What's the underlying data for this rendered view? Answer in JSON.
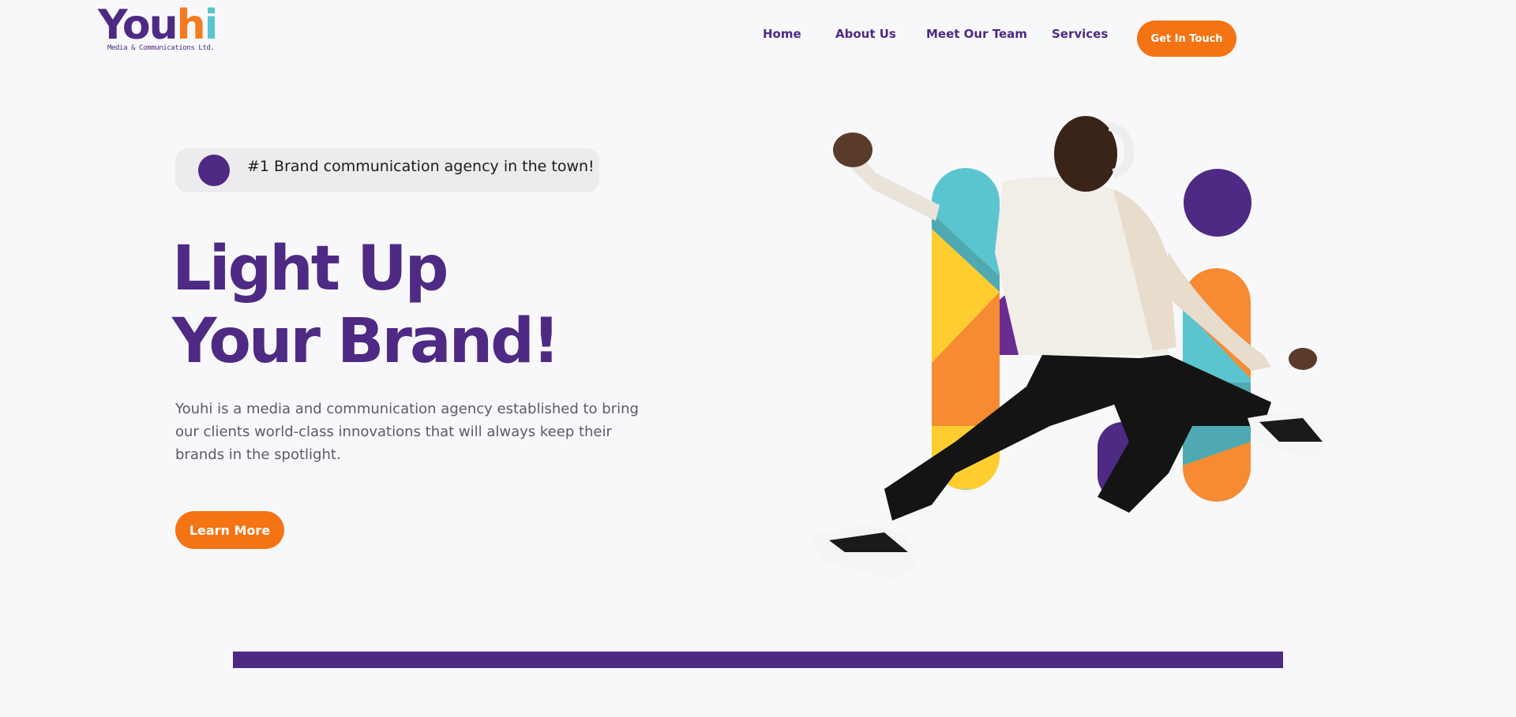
{
  "brand": {
    "name_part1": "Yo",
    "name_part2": "u",
    "name_h": "h",
    "name_i": "i",
    "tagline": "Media & Communications Ltd."
  },
  "nav": {
    "items": [
      {
        "label": "Home"
      },
      {
        "label": "About Us"
      },
      {
        "label": "Meet Our Team"
      },
      {
        "label": "Services"
      }
    ],
    "cta_label": "Get In Touch"
  },
  "hero": {
    "badge_text": "#1 Brand communication agency in the town!",
    "headline_line1": "Light Up",
    "headline_line2": "Your Brand!",
    "description": "Youhi is a media and communication agency established to bring our clients world-class innovations that will always keep their brands in the spotlight.",
    "button_label": "Learn More",
    "image_alt": "Jumping man with headphones in front of colorful logo shapes"
  },
  "colors": {
    "primary_purple": "#4e2a84",
    "accent_orange": "#f47313",
    "teal": "#5bc5cf",
    "yellow": "#ffcd2f",
    "background": "#f8f8fa"
  }
}
